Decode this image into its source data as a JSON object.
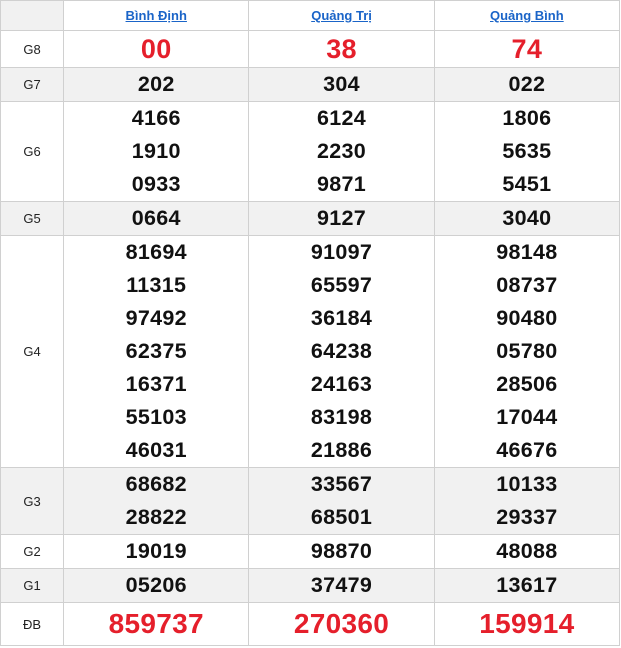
{
  "provinces": [
    "Bình Định",
    "Quảng Trị",
    "Quảng Bình"
  ],
  "rows": [
    {
      "label": "G8",
      "values": [
        [
          "00"
        ],
        [
          "38"
        ],
        [
          "74"
        ]
      ]
    },
    {
      "label": "G7",
      "values": [
        [
          "202"
        ],
        [
          "304"
        ],
        [
          "022"
        ]
      ]
    },
    {
      "label": "G6",
      "values": [
        [
          "4166",
          "1910",
          "0933"
        ],
        [
          "6124",
          "2230",
          "9871"
        ],
        [
          "1806",
          "5635",
          "5451"
        ]
      ]
    },
    {
      "label": "G5",
      "values": [
        [
          "0664"
        ],
        [
          "9127"
        ],
        [
          "3040"
        ]
      ]
    },
    {
      "label": "G4",
      "values": [
        [
          "81694",
          "11315",
          "97492",
          "62375",
          "16371",
          "55103",
          "46031"
        ],
        [
          "91097",
          "65597",
          "36184",
          "64238",
          "24163",
          "83198",
          "21886"
        ],
        [
          "98148",
          "08737",
          "90480",
          "05780",
          "28506",
          "17044",
          "46676"
        ]
      ]
    },
    {
      "label": "G3",
      "values": [
        [
          "68682",
          "28822"
        ],
        [
          "33567",
          "68501"
        ],
        [
          "10133",
          "29337"
        ]
      ]
    },
    {
      "label": "G2",
      "values": [
        [
          "19019"
        ],
        [
          "98870"
        ],
        [
          "48088"
        ]
      ]
    },
    {
      "label": "G1",
      "values": [
        [
          "05206"
        ],
        [
          "37479"
        ],
        [
          "13617"
        ]
      ]
    },
    {
      "label": "ĐB",
      "values": [
        [
          "859737"
        ],
        [
          "270360"
        ],
        [
          "159914"
        ]
      ]
    }
  ],
  "colors": {
    "highlight": "#e51f2b",
    "link": "#1a64c8",
    "shade": "#f1f1f1"
  }
}
